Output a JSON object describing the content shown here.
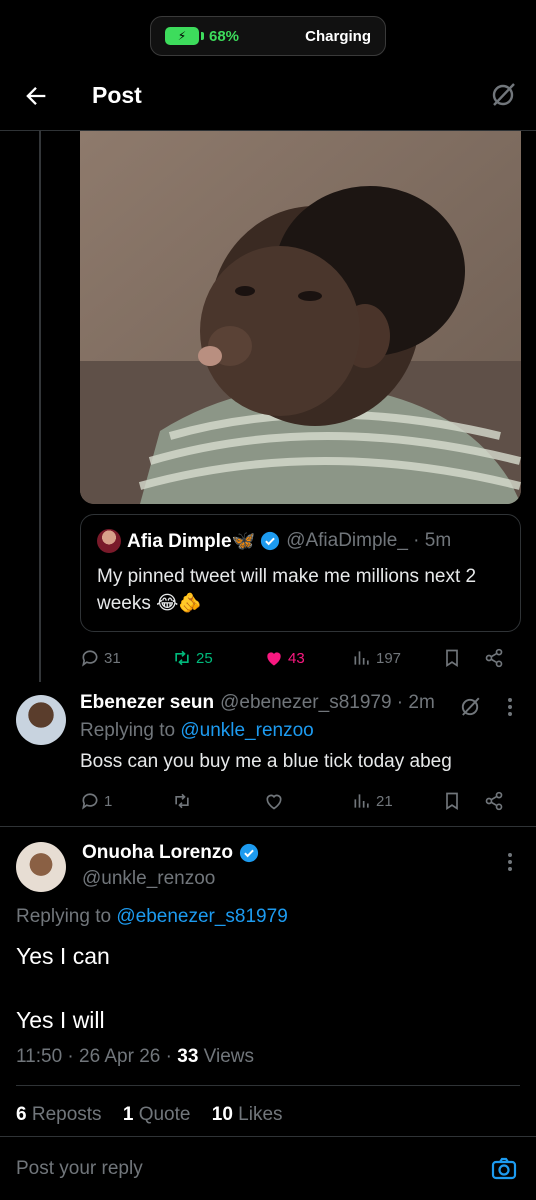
{
  "status": {
    "battery_percent": "68%",
    "charging_label": "Charging"
  },
  "header": {
    "title": "Post"
  },
  "quote": {
    "name": "Afia Dimple🦋",
    "handle": "@AfiaDimple_ · 5m",
    "text": "My pinned tweet will make me millions next 2 weeks 😂🫵"
  },
  "actions1": {
    "replies": "31",
    "reposts": "25",
    "likes": "43",
    "views": "197"
  },
  "reply1": {
    "name": "Ebenezer seun",
    "handle": "@ebenezer_s81979 · 2m",
    "replying_prefix": "Replying to",
    "replying_to": "@unkle_renzoo",
    "text": "Boss can you buy me a blue tick today abeg"
  },
  "actions2": {
    "replies": "1",
    "views": "21"
  },
  "main": {
    "name": "Onuoha Lorenzo",
    "handle": "@unkle_renzoo",
    "replying_prefix": "Replying to",
    "replying_to": "@ebenezer_s81979",
    "line1": "Yes I can",
    "line2": "Yes I will",
    "time": "11:50 · 26 Apr 26 · ",
    "views_count": "33",
    "views_label": " Views",
    "reposts_count": "6",
    "reposts_label": " Reposts",
    "quotes_count": "1",
    "quotes_label": " Quote",
    "likes_count": "10",
    "likes_label": " Likes"
  },
  "compose": {
    "placeholder": "Post your reply"
  },
  "colors": {
    "accent": "#1d9bf0",
    "repost": "#00ba7c",
    "like": "#f91880",
    "muted": "#71767b"
  }
}
